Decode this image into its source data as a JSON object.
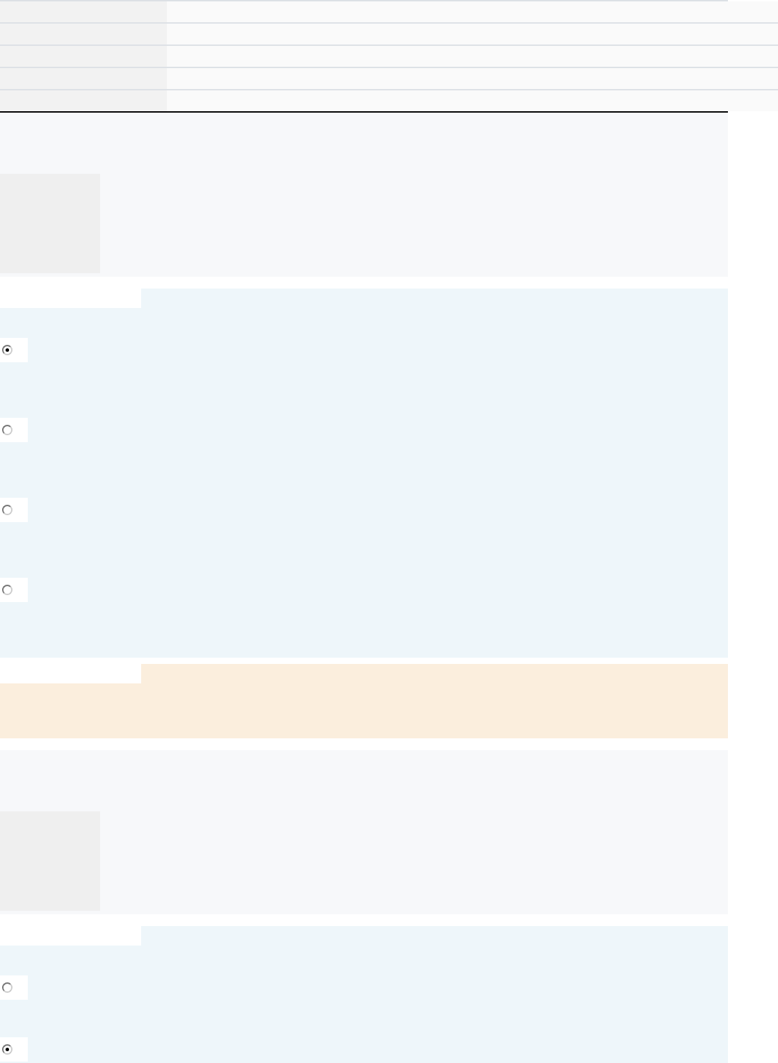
{
  "sections": [
    {
      "kind": "table",
      "rows": [
        {
          "kind": "row"
        },
        {
          "kind": "row"
        },
        {
          "kind": "row"
        },
        {
          "kind": "row"
        },
        {
          "kind": "row"
        }
      ]
    },
    {
      "kind": "question",
      "media": {
        "kind": "placeholder"
      }
    },
    {
      "kind": "options",
      "options": [
        {
          "selected": true
        },
        {
          "selected": false
        },
        {
          "selected": false
        },
        {
          "selected": false
        }
      ]
    },
    {
      "kind": "note"
    },
    {
      "kind": "question",
      "media": {
        "kind": "placeholder"
      }
    },
    {
      "kind": "options",
      "options": [
        {
          "selected": false
        },
        {
          "selected": true
        }
      ]
    }
  ]
}
